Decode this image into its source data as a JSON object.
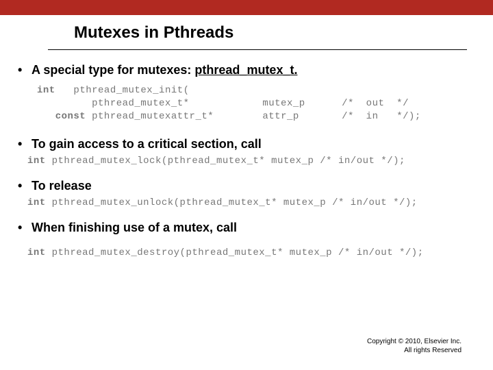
{
  "slide": {
    "title": "Mutexes in Pthreads",
    "bullets": {
      "b1_pre": "A special type for mutexes:  ",
      "b1_typename": "pthread_mutex_t.",
      "b2": "To gain access to a critical section, call",
      "b3": "To release",
      "b4": "When finishing use of a mutex, call"
    },
    "code": {
      "init_l1_kw": "int",
      "init_l1_rest": "   pthread_mutex_init(",
      "init_l2": "         pthread_mutex_t*            mutex_p      /*  out  */",
      "init_l3_kw": "   const",
      "init_l3_rest": " pthread_mutexattr_t*        attr_p       /*  in   */);",
      "lock_kw": "int",
      "lock_rest": "  pthread_mutex_lock(pthread_mutex_t*  mutex_p   /*  in/out  */);",
      "unlock_kw": "int",
      "unlock_rest": "  pthread_mutex_unlock(pthread_mutex_t*  mutex_p   /*  in/out  */);",
      "destroy_kw": "int",
      "destroy_rest": "  pthread_mutex_destroy(pthread_mutex_t*  mutex_p   /*  in/out  */);"
    },
    "footer": {
      "line1": "Copyright © 2010, Elsevier Inc.",
      "line2": "All rights Reserved"
    }
  }
}
